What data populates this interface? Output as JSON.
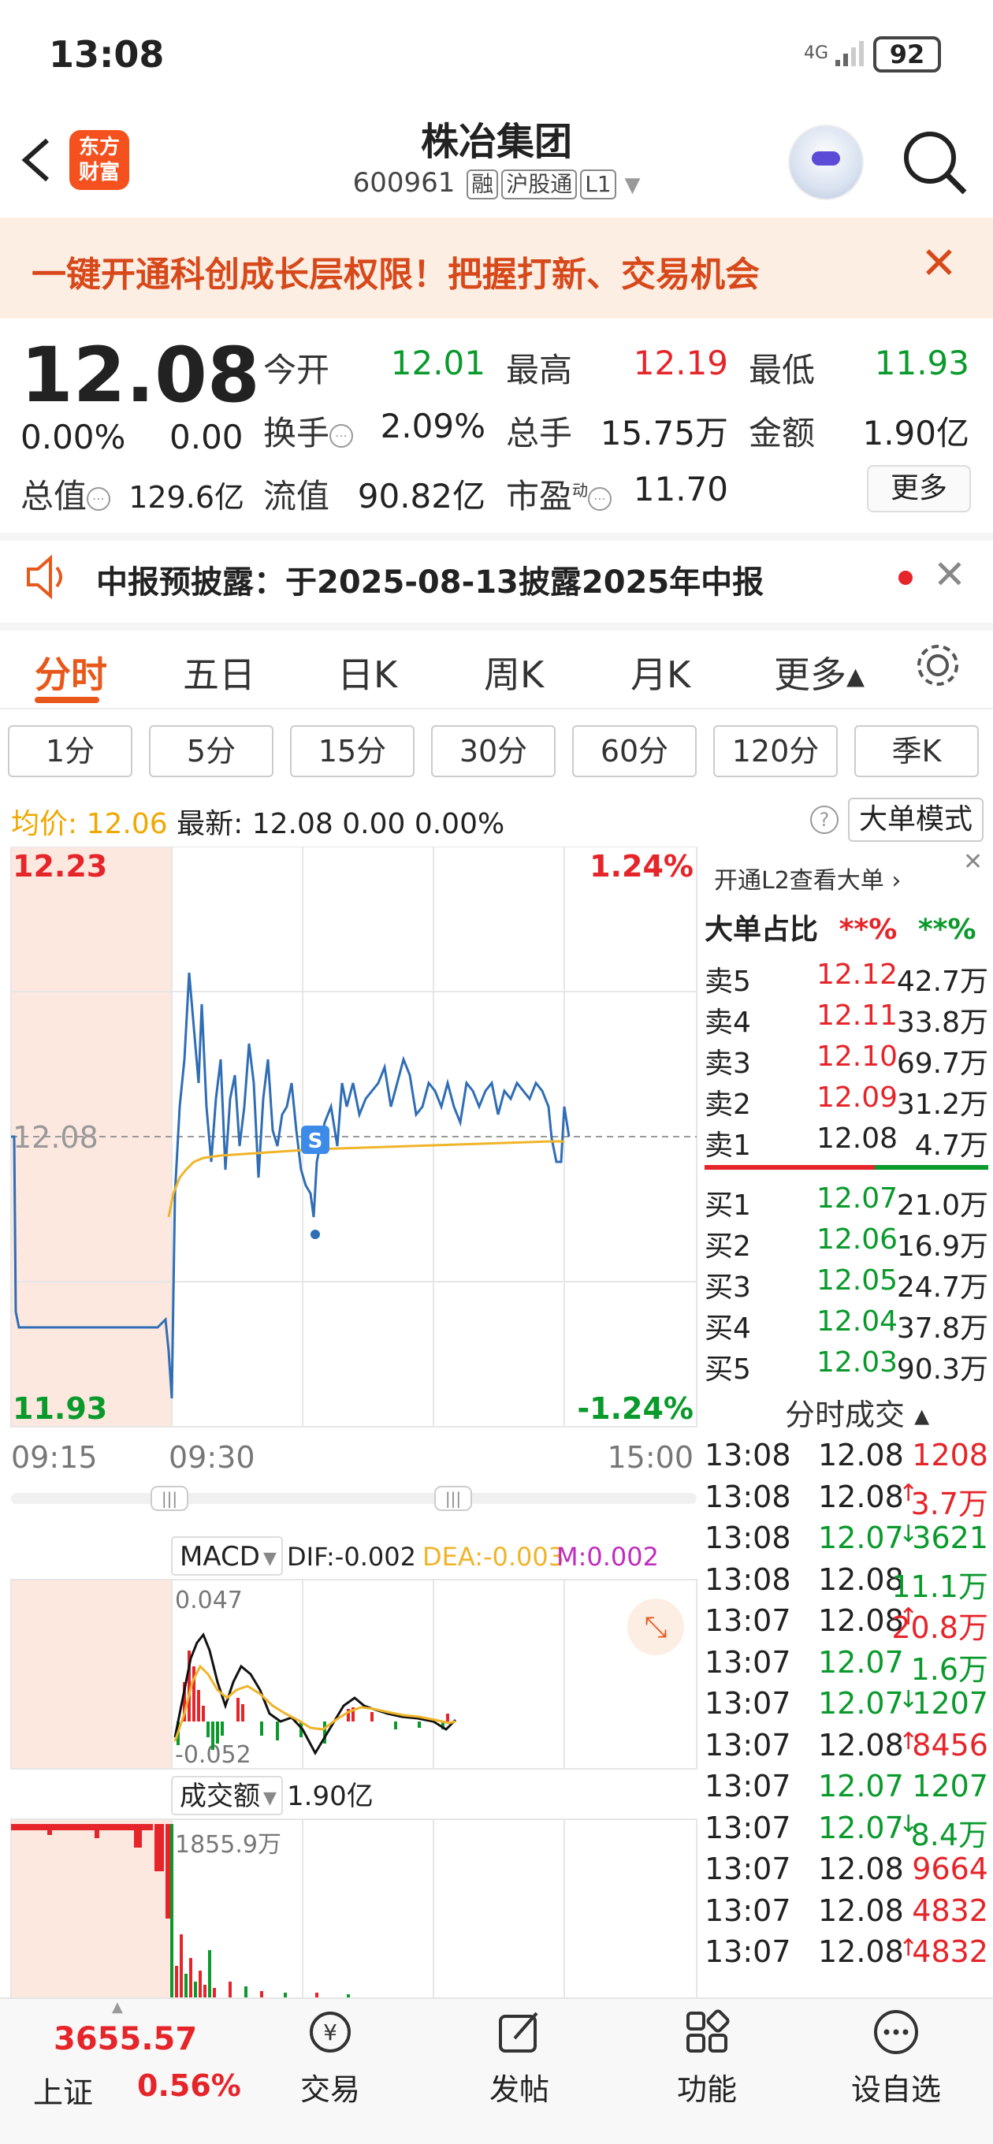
{
  "status_bar": {
    "time": "13:08",
    "network": "4G",
    "battery": "92"
  },
  "header": {
    "brand_line1": "东方",
    "brand_line2": "财富",
    "stock_name": "株冶集团",
    "stock_code": "600961",
    "tags": [
      "融",
      "沪股通",
      "L1"
    ]
  },
  "promo": {
    "text": "一键开通科创成长层权限！把握打新、交易机会"
  },
  "quote": {
    "price": "12.08",
    "change_pct": "0.00%",
    "change_val": "0.00",
    "open_label": "今开",
    "open": "12.01",
    "high_label": "最高",
    "high": "12.19",
    "low_label": "最低",
    "low": "11.93",
    "turnover_label": "换手",
    "turnover": "2.09%",
    "volume_label": "总手",
    "volume": "15.75万",
    "amount_label": "金额",
    "amount": "1.90亿",
    "mktcap_label": "总值",
    "mktcap": "129.6亿",
    "float_label": "流值",
    "float_cap": "90.82亿",
    "pe_label": "市盈",
    "pe_sup": "动",
    "pe": "11.70",
    "more": "更多"
  },
  "notice": {
    "text": "中报预披露：于2025-08-13披露2025年中报"
  },
  "tabs": [
    "分时",
    "五日",
    "日K",
    "周K",
    "月K",
    "更多▴"
  ],
  "minute_buttons": [
    "1分",
    "5分",
    "15分",
    "30分",
    "60分",
    "120分",
    "季K"
  ],
  "avg_row": {
    "avg_label": "均价:",
    "avg": "12.06",
    "latest_label": "最新:",
    "latest": "12.08",
    "chg": "0.00",
    "pct": "0.00%",
    "big_mode": "大单模式"
  },
  "chart": {
    "y_top": "12.23",
    "y_mid": "12.08",
    "y_bot": "11.93",
    "pct_top": "1.24%",
    "pct_bot": "-1.24%",
    "x_ticks": [
      "09:15",
      "09:30",
      "15:00"
    ],
    "macd_label": "MACD",
    "dif": "DIF:-0.002",
    "dea": "DEA:-0.003",
    "m": "M:0.002",
    "macd_top": "0.047",
    "macd_bot": "-0.052",
    "vol_label": "成交额",
    "vol_total": "1.90亿",
    "vol_max": "1855.9万",
    "marker": "S",
    "colors": {
      "price_line": "#2f6db5",
      "avg_line": "#f0b429",
      "up": "#e5252a",
      "down": "#0a9a2c"
    }
  },
  "order_book": {
    "promo": "开通L2查看大单 ›",
    "ratio_label": "大单占比",
    "ratio_buy": "**%",
    "ratio_sell": "**%",
    "asks": [
      {
        "label": "卖5",
        "price": "12.12",
        "vol": "42.7万",
        "color": "red"
      },
      {
        "label": "卖4",
        "price": "12.11",
        "vol": "33.8万",
        "color": "red"
      },
      {
        "label": "卖3",
        "price": "12.10",
        "vol": "69.7万",
        "color": "red"
      },
      {
        "label": "卖2",
        "price": "12.09",
        "vol": "31.2万",
        "color": "red"
      },
      {
        "label": "卖1",
        "price": "12.08",
        "vol": "4.7万",
        "color": "black"
      }
    ],
    "bids": [
      {
        "label": "买1",
        "price": "12.07",
        "vol": "21.0万",
        "color": "green"
      },
      {
        "label": "买2",
        "price": "12.06",
        "vol": "16.9万",
        "color": "green"
      },
      {
        "label": "买3",
        "price": "12.05",
        "vol": "24.7万",
        "color": "green"
      },
      {
        "label": "买4",
        "price": "12.04",
        "vol": "37.8万",
        "color": "green"
      },
      {
        "label": "买5",
        "price": "12.03",
        "vol": "90.3万",
        "color": "green"
      }
    ]
  },
  "trades": {
    "title": "分时成交 ▴",
    "rows": [
      {
        "time": "13:08",
        "price": "12.08",
        "arrow": "",
        "vol": "1208",
        "pc": "black",
        "vc": "red"
      },
      {
        "time": "13:08",
        "price": "12.08",
        "arrow": "↑",
        "vol": "3.7万",
        "pc": "black",
        "vc": "red"
      },
      {
        "time": "13:08",
        "price": "12.07",
        "arrow": "↓",
        "vol": "3621",
        "pc": "green",
        "vc": "green"
      },
      {
        "time": "13:08",
        "price": "12.08",
        "arrow": "",
        "vol": "11.1万",
        "pc": "black",
        "vc": "green"
      },
      {
        "time": "13:07",
        "price": "12.08",
        "arrow": "↑",
        "vol": "20.8万",
        "pc": "black",
        "vc": "red"
      },
      {
        "time": "13:07",
        "price": "12.07",
        "arrow": "",
        "vol": "1.6万",
        "pc": "green",
        "vc": "green"
      },
      {
        "time": "13:07",
        "price": "12.07",
        "arrow": "↓",
        "vol": "1207",
        "pc": "green",
        "vc": "green"
      },
      {
        "time": "13:07",
        "price": "12.08",
        "arrow": "↑",
        "vol": "8456",
        "pc": "black",
        "vc": "red"
      },
      {
        "time": "13:07",
        "price": "12.07",
        "arrow": "",
        "vol": "1207",
        "pc": "green",
        "vc": "green"
      },
      {
        "time": "13:07",
        "price": "12.07",
        "arrow": "↓",
        "vol": "8.4万",
        "pc": "green",
        "vc": "green"
      },
      {
        "time": "13:07",
        "price": "12.08",
        "arrow": "",
        "vol": "9664",
        "pc": "black",
        "vc": "red"
      },
      {
        "time": "13:07",
        "price": "12.08",
        "arrow": "",
        "vol": "4832",
        "pc": "black",
        "vc": "red"
      },
      {
        "time": "13:07",
        "price": "12.08",
        "arrow": "↑",
        "vol": "4832",
        "pc": "black",
        "vc": "red"
      }
    ]
  },
  "bottom_nav": {
    "index_value": "3655.57",
    "index_name": "上证",
    "index_pct": "0.56%",
    "items": [
      "交易",
      "发帖",
      "功能",
      "设自选"
    ]
  }
}
